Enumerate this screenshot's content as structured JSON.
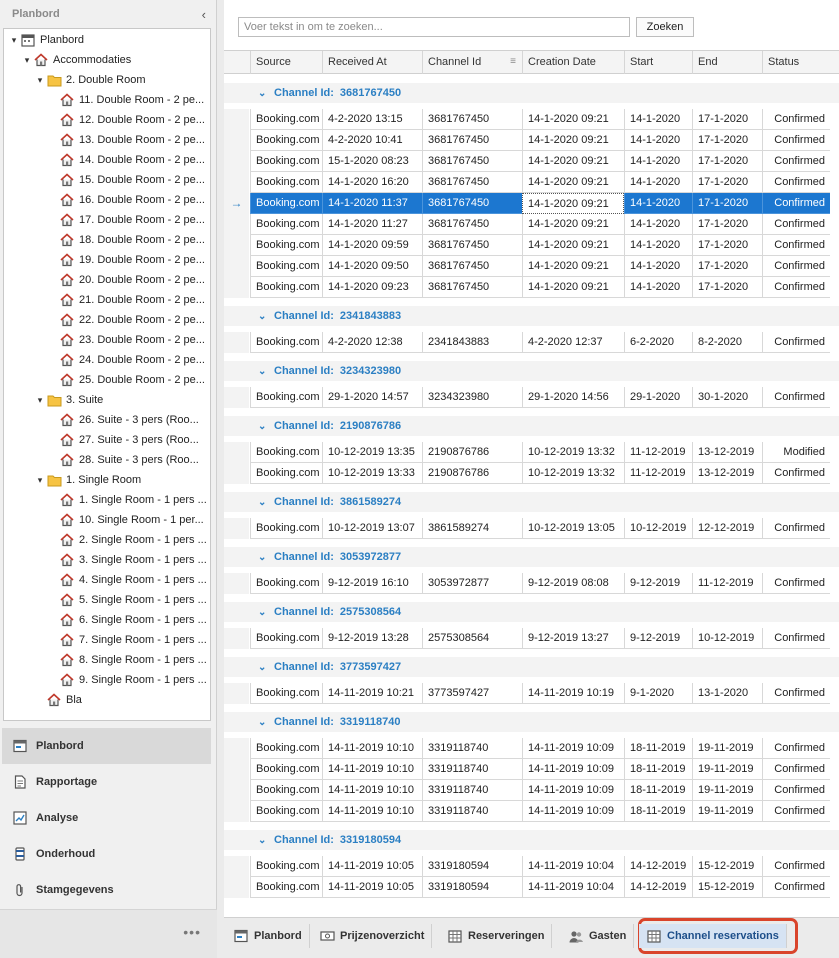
{
  "left_panel": {
    "title": "Planbord",
    "collapse_icon": "chevron-left-icon",
    "tree": [
      {
        "label": "Planbord",
        "level": 0,
        "icon": "calendar-icon",
        "expander": "▾"
      },
      {
        "label": "Accommodaties",
        "level": 1,
        "icon": "house-icon",
        "expander": "▾"
      },
      {
        "label": "2. Double Room",
        "level": 2,
        "icon": "folder-icon",
        "expander": "▾"
      },
      {
        "label": "11. Double Room - 2 pe...",
        "level": 3,
        "icon": "house-icon"
      },
      {
        "label": "12. Double Room - 2 pe...",
        "level": 3,
        "icon": "house-icon"
      },
      {
        "label": "13. Double Room - 2 pe...",
        "level": 3,
        "icon": "house-icon"
      },
      {
        "label": "14. Double Room - 2 pe...",
        "level": 3,
        "icon": "house-icon"
      },
      {
        "label": "15. Double Room - 2 pe...",
        "level": 3,
        "icon": "house-icon"
      },
      {
        "label": "16. Double Room - 2 pe...",
        "level": 3,
        "icon": "house-icon"
      },
      {
        "label": "17. Double Room - 2 pe...",
        "level": 3,
        "icon": "house-icon"
      },
      {
        "label": "18. Double Room - 2 pe...",
        "level": 3,
        "icon": "house-icon"
      },
      {
        "label": "19. Double Room - 2 pe...",
        "level": 3,
        "icon": "house-icon"
      },
      {
        "label": "20. Double Room - 2 pe...",
        "level": 3,
        "icon": "house-icon"
      },
      {
        "label": "21. Double Room - 2 pe...",
        "level": 3,
        "icon": "house-icon"
      },
      {
        "label": "22. Double Room - 2 pe...",
        "level": 3,
        "icon": "house-icon"
      },
      {
        "label": "23. Double Room - 2 pe...",
        "level": 3,
        "icon": "house-icon"
      },
      {
        "label": "24. Double Room - 2 pe...",
        "level": 3,
        "icon": "house-icon"
      },
      {
        "label": "25. Double Room - 2 pe...",
        "level": 3,
        "icon": "house-icon"
      },
      {
        "label": "3. Suite",
        "level": 2,
        "icon": "folder-icon",
        "expander": "▾"
      },
      {
        "label": "26. Suite - 3 pers (Roo...",
        "level": 3,
        "icon": "house-icon"
      },
      {
        "label": "27. Suite - 3 pers (Roo...",
        "level": 3,
        "icon": "house-icon"
      },
      {
        "label": "28. Suite - 3 pers (Roo...",
        "level": 3,
        "icon": "house-icon"
      },
      {
        "label": "1. Single Room",
        "level": 2,
        "icon": "folder-icon",
        "expander": "▾"
      },
      {
        "label": "1. Single Room - 1 pers ...",
        "level": 3,
        "icon": "house-icon"
      },
      {
        "label": "10. Single Room - 1 per...",
        "level": 3,
        "icon": "house-icon"
      },
      {
        "label": "2. Single Room - 1 pers ...",
        "level": 3,
        "icon": "house-icon"
      },
      {
        "label": "3. Single Room - 1 pers ...",
        "level": 3,
        "icon": "house-icon"
      },
      {
        "label": "4. Single Room - 1 pers ...",
        "level": 3,
        "icon": "house-icon"
      },
      {
        "label": "5. Single Room - 1 pers ...",
        "level": 3,
        "icon": "house-icon"
      },
      {
        "label": "6. Single Room - 1 pers ...",
        "level": 3,
        "icon": "house-icon"
      },
      {
        "label": "7. Single Room - 1 pers ...",
        "level": 3,
        "icon": "house-icon"
      },
      {
        "label": "8. Single Room - 1 pers ...",
        "level": 3,
        "icon": "house-icon"
      },
      {
        "label": "9. Single Room - 1 pers ...",
        "level": 3,
        "icon": "house-icon"
      },
      {
        "label": "Bla",
        "level": 2,
        "icon": "house-icon"
      }
    ],
    "nav": [
      {
        "label": "Planbord",
        "icon": "planbord-icon",
        "active": true
      },
      {
        "label": "Rapportage",
        "icon": "report-icon",
        "active": false
      },
      {
        "label": "Analyse",
        "icon": "analysis-icon",
        "active": false
      },
      {
        "label": "Onderhoud",
        "icon": "maintenance-icon",
        "active": false
      },
      {
        "label": "Stamgegevens",
        "icon": "paperclip-icon",
        "active": false
      }
    ],
    "more_label": "•••"
  },
  "search": {
    "placeholder": "Voer tekst in om te zoeken...",
    "button_label": "Zoeken"
  },
  "grid": {
    "columns": [
      "Source",
      "Received At",
      "Channel Id",
      "Creation Date",
      "Start",
      "End",
      "Status"
    ],
    "group_label": "Channel Id:",
    "groups": [
      {
        "id": "3681767450",
        "rows": [
          [
            "Booking.com",
            "4-2-2020 13:15",
            "3681767450",
            "14-1-2020 09:21",
            "14-1-2020",
            "17-1-2020",
            "Confirmed"
          ],
          [
            "Booking.com",
            "4-2-2020 10:41",
            "3681767450",
            "14-1-2020 09:21",
            "14-1-2020",
            "17-1-2020",
            "Confirmed"
          ],
          [
            "Booking.com",
            "15-1-2020 08:23",
            "3681767450",
            "14-1-2020 09:21",
            "14-1-2020",
            "17-1-2020",
            "Confirmed"
          ],
          [
            "Booking.com",
            "14-1-2020 16:20",
            "3681767450",
            "14-1-2020 09:21",
            "14-1-2020",
            "17-1-2020",
            "Confirmed"
          ],
          [
            "Booking.com",
            "14-1-2020 11:37",
            "3681767450",
            "14-1-2020 09:21",
            "14-1-2020",
            "17-1-2020",
            "Confirmed"
          ],
          [
            "Booking.com",
            "14-1-2020 11:27",
            "3681767450",
            "14-1-2020 09:21",
            "14-1-2020",
            "17-1-2020",
            "Confirmed"
          ],
          [
            "Booking.com",
            "14-1-2020 09:59",
            "3681767450",
            "14-1-2020 09:21",
            "14-1-2020",
            "17-1-2020",
            "Confirmed"
          ],
          [
            "Booking.com",
            "14-1-2020 09:50",
            "3681767450",
            "14-1-2020 09:21",
            "14-1-2020",
            "17-1-2020",
            "Confirmed"
          ],
          [
            "Booking.com",
            "14-1-2020 09:23",
            "3681767450",
            "14-1-2020 09:21",
            "14-1-2020",
            "17-1-2020",
            "Confirmed"
          ]
        ]
      },
      {
        "id": "2341843883",
        "rows": [
          [
            "Booking.com",
            "4-2-2020 12:38",
            "2341843883",
            "4-2-2020 12:37",
            "6-2-2020",
            "8-2-2020",
            "Confirmed"
          ]
        ]
      },
      {
        "id": "3234323980",
        "rows": [
          [
            "Booking.com",
            "29-1-2020 14:57",
            "3234323980",
            "29-1-2020 14:56",
            "29-1-2020",
            "30-1-2020",
            "Confirmed"
          ]
        ]
      },
      {
        "id": "2190876786",
        "rows": [
          [
            "Booking.com",
            "10-12-2019 13:35",
            "2190876786",
            "10-12-2019 13:32",
            "11-12-2019",
            "13-12-2019",
            "Modified"
          ],
          [
            "Booking.com",
            "10-12-2019 13:33",
            "2190876786",
            "10-12-2019 13:32",
            "11-12-2019",
            "13-12-2019",
            "Confirmed"
          ]
        ]
      },
      {
        "id": "3861589274",
        "rows": [
          [
            "Booking.com",
            "10-12-2019 13:07",
            "3861589274",
            "10-12-2019 13:05",
            "10-12-2019",
            "12-12-2019",
            "Confirmed"
          ]
        ]
      },
      {
        "id": "3053972877",
        "rows": [
          [
            "Booking.com",
            "9-12-2019 16:10",
            "3053972877",
            "9-12-2019 08:08",
            "9-12-2019",
            "11-12-2019",
            "Confirmed"
          ]
        ]
      },
      {
        "id": "2575308564",
        "rows": [
          [
            "Booking.com",
            "9-12-2019 13:28",
            "2575308564",
            "9-12-2019 13:27",
            "9-12-2019",
            "10-12-2019",
            "Confirmed"
          ]
        ]
      },
      {
        "id": "3773597427",
        "rows": [
          [
            "Booking.com",
            "14-11-2019 10:21",
            "3773597427",
            "14-11-2019 10:19",
            "9-1-2020",
            "13-1-2020",
            "Confirmed"
          ]
        ]
      },
      {
        "id": "3319118740",
        "rows": [
          [
            "Booking.com",
            "14-11-2019 10:10",
            "3319118740",
            "14-11-2019 10:09",
            "18-11-2019",
            "19-11-2019",
            "Confirmed"
          ],
          [
            "Booking.com",
            "14-11-2019 10:10",
            "3319118740",
            "14-11-2019 10:09",
            "18-11-2019",
            "19-11-2019",
            "Confirmed"
          ],
          [
            "Booking.com",
            "14-11-2019 10:10",
            "3319118740",
            "14-11-2019 10:09",
            "18-11-2019",
            "19-11-2019",
            "Confirmed"
          ],
          [
            "Booking.com",
            "14-11-2019 10:10",
            "3319118740",
            "14-11-2019 10:09",
            "18-11-2019",
            "19-11-2019",
            "Confirmed"
          ]
        ]
      },
      {
        "id": "3319180594",
        "rows": [
          [
            "Booking.com",
            "14-11-2019 10:05",
            "3319180594",
            "14-11-2019 10:04",
            "14-12-2019",
            "15-12-2019",
            "Confirmed"
          ],
          [
            "Booking.com",
            "14-11-2019 10:05",
            "3319180594",
            "14-11-2019 10:04",
            "14-12-2019",
            "15-12-2019",
            "Confirmed"
          ]
        ]
      }
    ],
    "selected_group": 0,
    "selected_row": 4,
    "selected_indicator": "→"
  },
  "tabs": [
    {
      "label": "Planbord",
      "icon": "planbord-icon",
      "active": false
    },
    {
      "label": "Prijzenoverzicht",
      "icon": "price-icon",
      "active": false
    },
    {
      "label": "Reserveringen",
      "icon": "table-icon",
      "active": false
    },
    {
      "label": "Gasten",
      "icon": "guests-icon",
      "active": false
    },
    {
      "label": "Channel reservations",
      "icon": "table-icon",
      "active": true
    }
  ],
  "colors": {
    "accent": "#2b7fc3",
    "selection": "#1c77d0",
    "highlight_outline": "#d9442b"
  }
}
